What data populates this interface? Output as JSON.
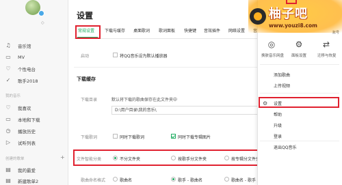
{
  "sidebar": {
    "vip_text": "◇",
    "items_top": [
      {
        "icon": "♫",
        "label": "音乐馆"
      },
      {
        "icon": "▭",
        "label": "MV"
      },
      {
        "icon": "♡",
        "label": "个性电台"
      },
      {
        "icon": "✓",
        "label": "歌手2018"
      }
    ],
    "my_music_heading": "我的音乐",
    "items_mine": [
      {
        "icon": "♡",
        "label": "我喜欢"
      },
      {
        "icon": "▭",
        "label": "本地和下载"
      },
      {
        "icon": "◷",
        "label": "播放历史"
      },
      {
        "icon": "▷",
        "label": "试听列表"
      }
    ],
    "created_heading": "创建的歌单",
    "created_plus": "+",
    "items_created": [
      {
        "icon": "▤",
        "label": "我的最爱"
      },
      {
        "icon": "▤",
        "label": "新建歌单2"
      }
    ]
  },
  "settings": {
    "title": "设置",
    "tabs": [
      "常规设置",
      "下载与缓存",
      "桌面歌词",
      "歌词面板",
      "快捷键",
      "音效插件",
      "网络设置",
      "音"
    ],
    "startup": {
      "label": "启动",
      "option": "将QQ音乐设为默认播放器"
    },
    "download_section": "下载缓存",
    "download_dir": {
      "label": "下载目录",
      "hint": "默认将下载的歌曲保存在此文件夹中",
      "path": "D:\\用户目录\\我的音乐\\"
    },
    "download_lyrics": {
      "label": "下载歌词",
      "opt1": "同时下载歌词",
      "opt2": "同时下载专辑图片",
      "opt1_checked": false,
      "opt2_checked": true
    },
    "classify": {
      "label": "文件智能分类",
      "options": [
        "不分文件夹",
        "按歌手分文件夹",
        "按专辑分文件夹"
      ],
      "selected": 0
    },
    "naming": {
      "label": "歌曲命名格式",
      "options": [
        "歌曲名",
        "歌手 - 歌曲名",
        "歌曲名 - 歌手"
      ],
      "selected": 1
    }
  },
  "menu": {
    "top": [
      {
        "icon": "◎",
        "label": "换肤音乐网盘"
      },
      {
        "icon": "⚙",
        "label": "面板设置"
      },
      {
        "icon": "⇄",
        "label": "迁移与恢复"
      }
    ],
    "items": [
      "添加歌曲",
      "上传视频",
      "设置",
      "帮助",
      "升级",
      "登录",
      "退出QQ音乐"
    ],
    "partial_top_label": "账号"
  },
  "watermark": {
    "title": "柚子吧",
    "url": "www.youzi8.com"
  }
}
